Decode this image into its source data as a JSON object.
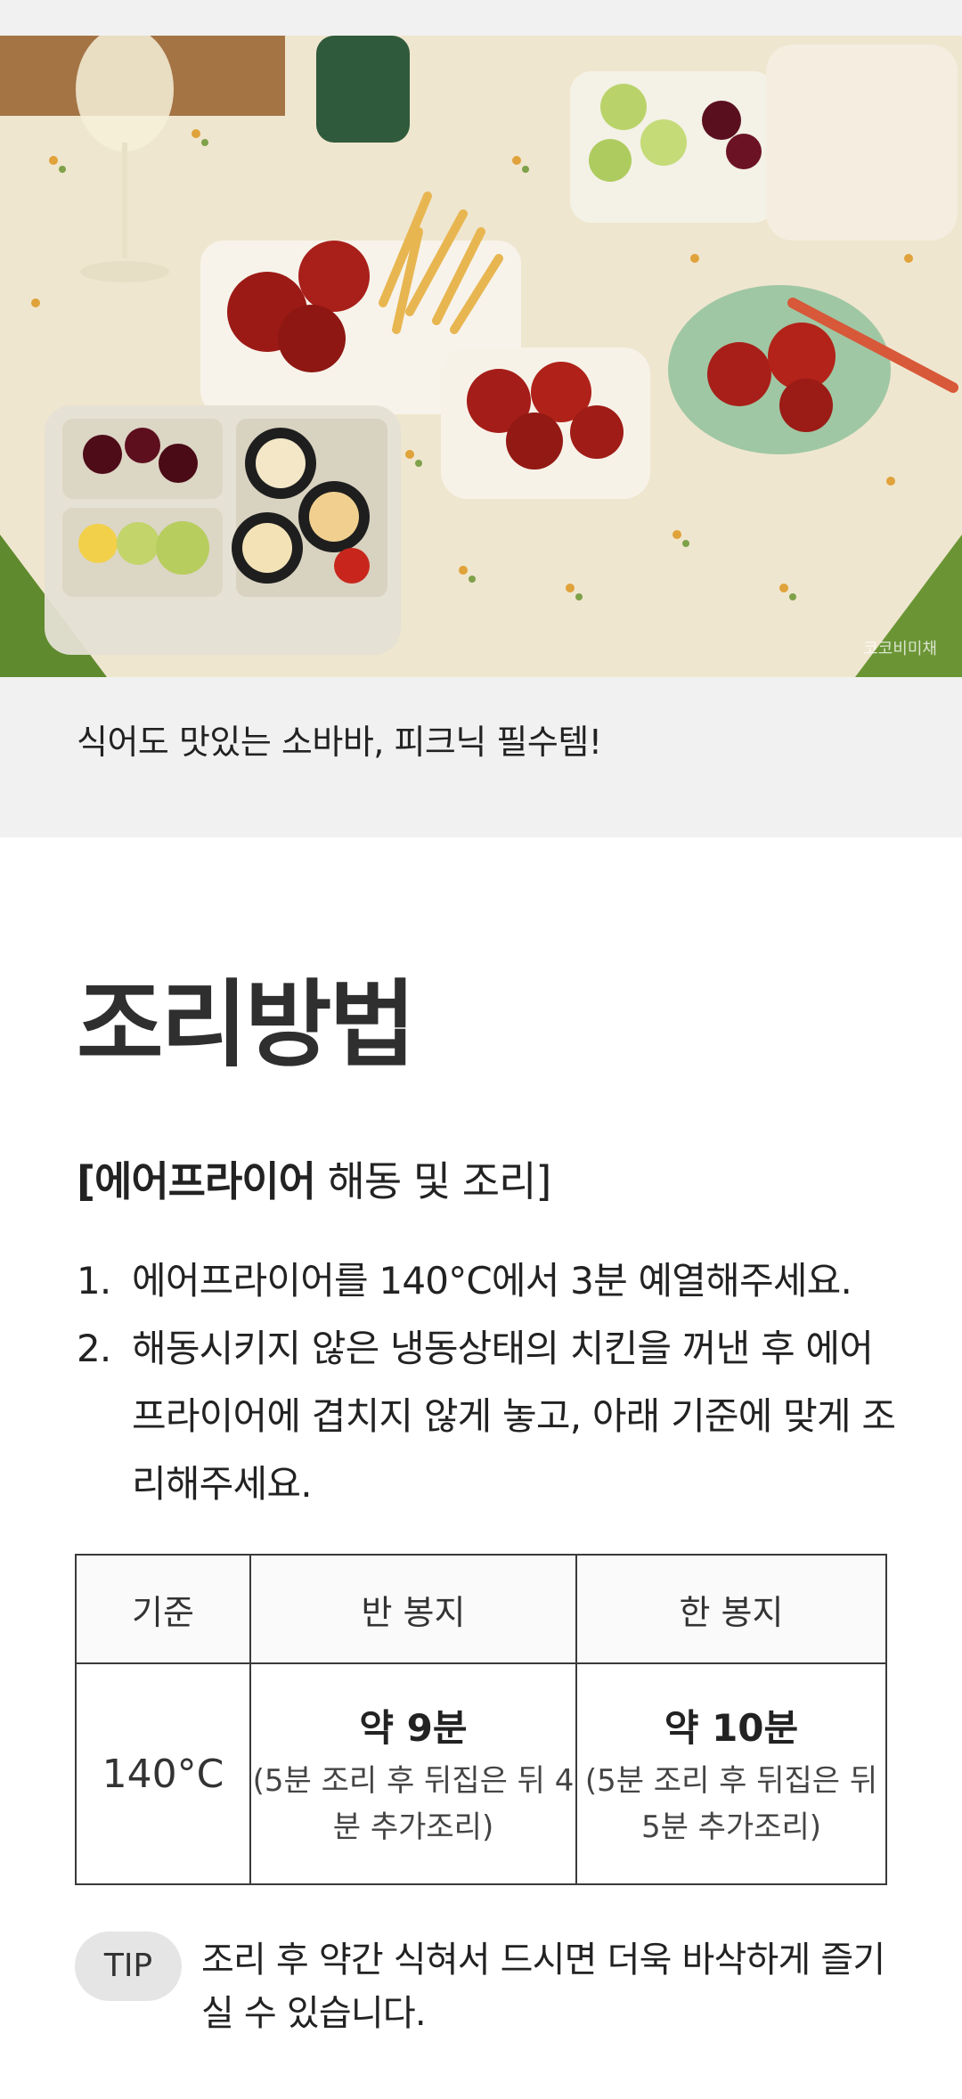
{
  "photo": {
    "alt_subject": "picnic-food-photo",
    "watermark": "코코비미채"
  },
  "caption": "식어도 맛있는 소바바, 피크닉 필수템!",
  "section": {
    "title": "조리방법",
    "subtitle_bold": "[에어프라이어",
    "subtitle_rest": " 해동 및 조리]"
  },
  "steps": [
    {
      "num": "1.",
      "text": "에어프라이어를 140°C에서 3분 예열해주세요."
    },
    {
      "num": "2.",
      "text": "해동시키지 않은 냉동상태의 치킨을 꺼낸 후 에어프라이어에 겹치지 않게 놓고, 아래 기준에 맞게 조리해주세요."
    }
  ],
  "table": {
    "headers": [
      "기준",
      "반 봉지",
      "한 봉지"
    ],
    "row": {
      "temp": "140°C",
      "half_time": "약 9분",
      "half_note": "(5분 조리 후 뒤집은 뒤 4분 추가조리)",
      "full_time": "약 10분",
      "full_note": "(5분 조리 후 뒤집은 뒤 5분 추가조리)"
    }
  },
  "tip": {
    "badge": "TIP",
    "text": "조리 후 약간 식혀서 드시면 더욱 바삭하게 즐기실 수 있습니다."
  },
  "colors": {
    "band_bg": "#f1f1f1",
    "table_border": "#3a3a3a",
    "tip_badge_bg": "#e5e5e5"
  }
}
